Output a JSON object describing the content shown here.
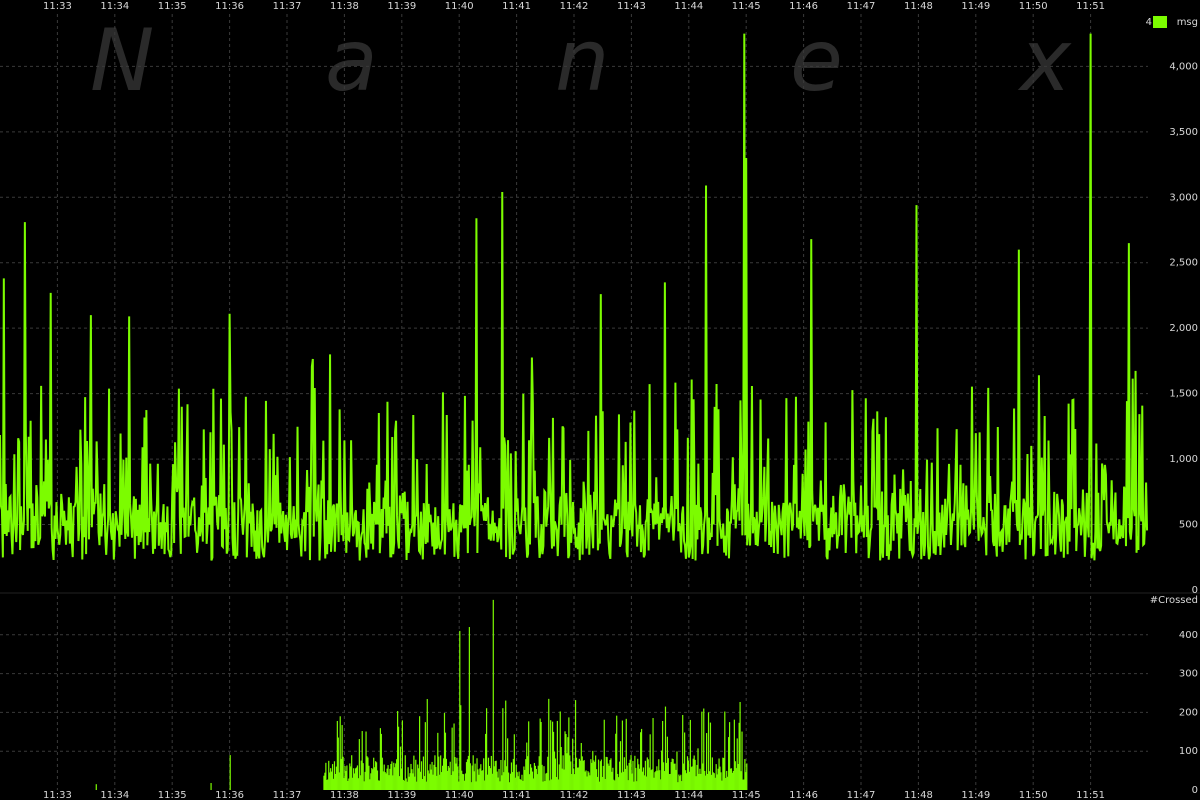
{
  "chart_data": [
    {
      "type": "bar",
      "panel": "message-rate",
      "units_label": "msg",
      "legend_label": "4",
      "series_color": "#7CFC00",
      "ylim": [
        0,
        4400
      ],
      "y_ticks": [
        0,
        500,
        1000,
        1500,
        2000,
        2500,
        3000,
        3500,
        4000
      ],
      "y_tick_labels": [
        "0",
        "500",
        "1,000",
        "1,500",
        "2,000",
        "2,500",
        "3,000",
        "3,500",
        "4,000"
      ],
      "x_tick_labels": [
        "11:33",
        "11:34",
        "11:35",
        "11:36",
        "11:37",
        "11:38",
        "11:39",
        "11:40",
        "11:41",
        "11:42",
        "11:43",
        "11:44",
        "11:45",
        "11:46",
        "11:47",
        "11:48",
        "11:49",
        "11:50",
        "11:51"
      ],
      "grid": true,
      "samples_per_minute": 60,
      "start_time": "11:32:00",
      "baseline": 500,
      "noise_seed": 7,
      "spikes": [
        {
          "time": "11:32:04",
          "value": 2380
        },
        {
          "time": "11:32:26",
          "value": 2810
        },
        {
          "time": "11:32:53",
          "value": 2270
        },
        {
          "time": "11:33:35",
          "value": 2100
        },
        {
          "time": "11:34:15",
          "value": 2090
        },
        {
          "time": "11:36:00",
          "value": 2110
        },
        {
          "time": "11:37:45",
          "value": 1800
        },
        {
          "time": "11:40:18",
          "value": 2840
        },
        {
          "time": "11:40:45",
          "value": 3040
        },
        {
          "time": "11:42:28",
          "value": 2260
        },
        {
          "time": "11:43:35",
          "value": 2350
        },
        {
          "time": "11:44:18",
          "value": 3090
        },
        {
          "time": "11:44:58",
          "value": 4250
        },
        {
          "time": "11:45:00",
          "value": 3300
        },
        {
          "time": "11:46:08",
          "value": 2680
        },
        {
          "time": "11:47:58",
          "value": 2940
        },
        {
          "time": "11:49:45",
          "value": 2600
        },
        {
          "time": "11:51:00",
          "value": 4250
        },
        {
          "time": "11:51:40",
          "value": 2650
        }
      ]
    },
    {
      "type": "bar",
      "panel": "crossed",
      "units_label": "#Crossed",
      "series_color": "#7CFC00",
      "ylim": [
        0,
        500
      ],
      "y_ticks": [
        0,
        100,
        200,
        300,
        400
      ],
      "y_tick_labels": [
        "0",
        "100",
        "200",
        "300",
        "400"
      ],
      "x_tick_labels": [
        "11:33",
        "11:34",
        "11:35",
        "11:36",
        "11:37",
        "11:38",
        "11:39",
        "11:40",
        "11:41",
        "11:42",
        "11:43",
        "11:44",
        "11:45",
        "11:46",
        "11:47",
        "11:48",
        "11:49",
        "11:50",
        "11:51"
      ],
      "grid": true,
      "samples_per_minute": 60,
      "start_time": "11:32:00",
      "active_from": "11:37:38",
      "active_to": "11:45:00",
      "noise_seed": 11,
      "spikes": [
        {
          "time": "11:33:40",
          "value": 15
        },
        {
          "time": "11:35:40",
          "value": 18
        },
        {
          "time": "11:36:00",
          "value": 90
        },
        {
          "time": "11:37:55",
          "value": 190
        },
        {
          "time": "11:40:00",
          "value": 410
        },
        {
          "time": "11:40:10",
          "value": 420
        },
        {
          "time": "11:40:35",
          "value": 490
        },
        {
          "time": "11:43:35",
          "value": 215
        },
        {
          "time": "11:44:15",
          "value": 210
        },
        {
          "time": "11:44:20",
          "value": 200
        }
      ]
    }
  ],
  "watermark": {
    "letters": [
      "N",
      "a",
      "n",
      "e",
      "x"
    ],
    "color": "#2a2a2a"
  }
}
